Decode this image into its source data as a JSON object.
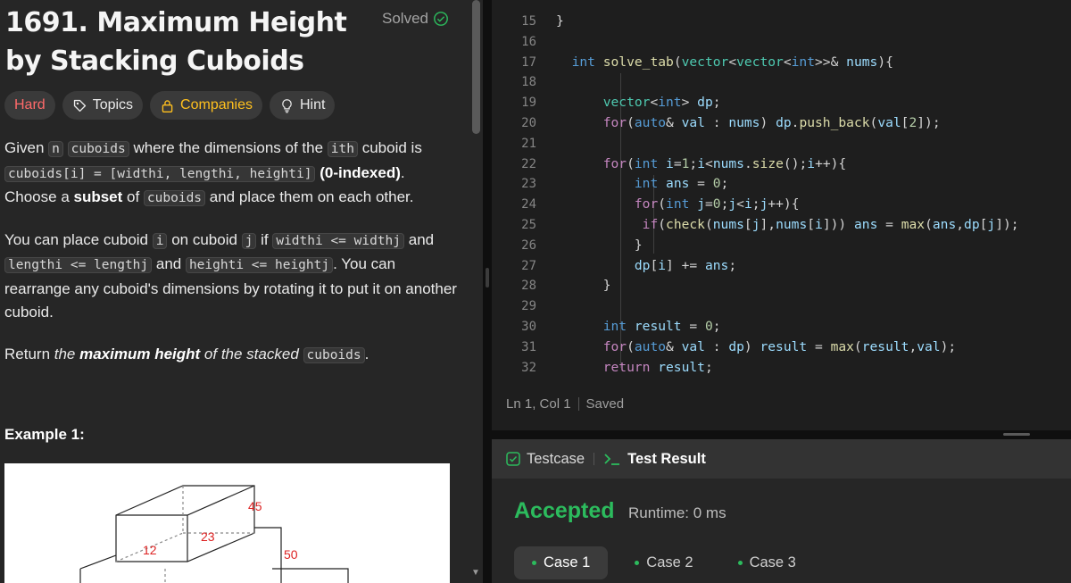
{
  "problem": {
    "title": "1691. Maximum Height by Stacking Cuboids",
    "solved_label": "Solved",
    "tags": {
      "difficulty": "Hard",
      "topics": "Topics",
      "companies": "Companies",
      "hint": "Hint"
    },
    "para1": {
      "t1": "Given ",
      "c1": "n",
      "t2": " ",
      "c2": "cuboids",
      "t3": " where the dimensions of the ",
      "c3": "ith",
      "t4": " cuboid is",
      "c4": "cuboids[i] = [widthi, lengthi, heighti]",
      "t5": " ",
      "b1": "(0-indexed)",
      "t6": ".",
      "t7": "Choose a ",
      "b2": "subset",
      "t8": " of ",
      "c5": "cuboids",
      "t9": " and place them on each other."
    },
    "para2": {
      "t1": "You can place cuboid ",
      "c1": "i",
      "t2": " on cuboid ",
      "c2": "j",
      "t3": " if ",
      "c3": "widthi <= widthj",
      "t4": " and",
      "c4": "lengthi <= lengthj",
      "t5": " and ",
      "c5": "heighti <= heightj",
      "t6": ". You can",
      "t7": "rearrange any cuboid's dimensions by rotating it to put it on another cuboid."
    },
    "para3": {
      "t1": "Return ",
      "i1": "the ",
      "b1": "maximum height",
      "i2": " of the stacked ",
      "c1": "cuboids",
      "t2": "."
    },
    "example_heading": "Example 1:",
    "figure_labels": {
      "a": "45",
      "b": "23",
      "c": "12",
      "d": "50"
    }
  },
  "editor": {
    "line_numbers": [
      "15",
      "16",
      "17",
      "18",
      "19",
      "20",
      "21",
      "22",
      "23",
      "24",
      "25",
      "26",
      "27",
      "28",
      "29",
      "30",
      "31",
      "32"
    ],
    "status_position": "Ln 1, Col 1",
    "status_saved": "Saved"
  },
  "result": {
    "tab_testcase": "Testcase",
    "tab_result": "Test Result",
    "verdict": "Accepted",
    "runtime": "Runtime: 0 ms",
    "cases": [
      "Case 1",
      "Case 2",
      "Case 3"
    ]
  },
  "colors": {
    "accepted": "#2cbb5d",
    "hard": "#ff6a6a",
    "companies": "#ffc01e"
  }
}
